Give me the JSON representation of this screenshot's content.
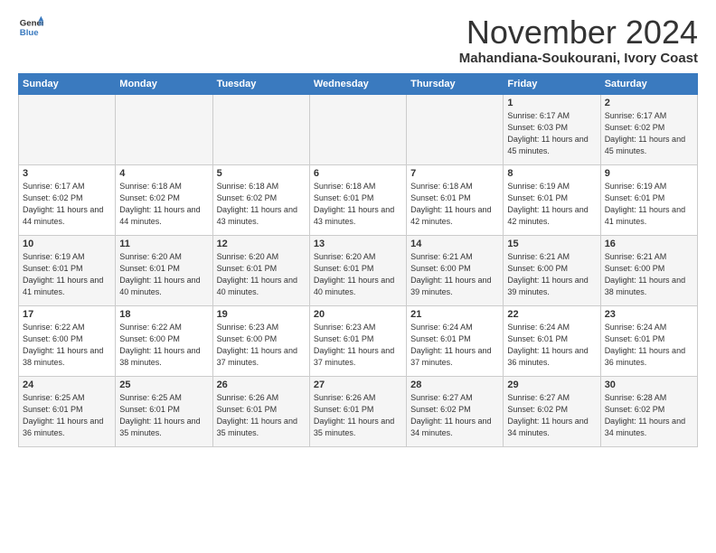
{
  "logo": {
    "general": "General",
    "blue": "Blue"
  },
  "title": "November 2024",
  "location": "Mahandiana-Soukourani, Ivory Coast",
  "days_header": [
    "Sunday",
    "Monday",
    "Tuesday",
    "Wednesday",
    "Thursday",
    "Friday",
    "Saturday"
  ],
  "weeks": [
    [
      {
        "day": "",
        "info": ""
      },
      {
        "day": "",
        "info": ""
      },
      {
        "day": "",
        "info": ""
      },
      {
        "day": "",
        "info": ""
      },
      {
        "day": "",
        "info": ""
      },
      {
        "day": "1",
        "info": "Sunrise: 6:17 AM\nSunset: 6:03 PM\nDaylight: 11 hours and 45 minutes."
      },
      {
        "day": "2",
        "info": "Sunrise: 6:17 AM\nSunset: 6:02 PM\nDaylight: 11 hours and 45 minutes."
      }
    ],
    [
      {
        "day": "3",
        "info": "Sunrise: 6:17 AM\nSunset: 6:02 PM\nDaylight: 11 hours and 44 minutes."
      },
      {
        "day": "4",
        "info": "Sunrise: 6:18 AM\nSunset: 6:02 PM\nDaylight: 11 hours and 44 minutes."
      },
      {
        "day": "5",
        "info": "Sunrise: 6:18 AM\nSunset: 6:02 PM\nDaylight: 11 hours and 43 minutes."
      },
      {
        "day": "6",
        "info": "Sunrise: 6:18 AM\nSunset: 6:01 PM\nDaylight: 11 hours and 43 minutes."
      },
      {
        "day": "7",
        "info": "Sunrise: 6:18 AM\nSunset: 6:01 PM\nDaylight: 11 hours and 42 minutes."
      },
      {
        "day": "8",
        "info": "Sunrise: 6:19 AM\nSunset: 6:01 PM\nDaylight: 11 hours and 42 minutes."
      },
      {
        "day": "9",
        "info": "Sunrise: 6:19 AM\nSunset: 6:01 PM\nDaylight: 11 hours and 41 minutes."
      }
    ],
    [
      {
        "day": "10",
        "info": "Sunrise: 6:19 AM\nSunset: 6:01 PM\nDaylight: 11 hours and 41 minutes."
      },
      {
        "day": "11",
        "info": "Sunrise: 6:20 AM\nSunset: 6:01 PM\nDaylight: 11 hours and 40 minutes."
      },
      {
        "day": "12",
        "info": "Sunrise: 6:20 AM\nSunset: 6:01 PM\nDaylight: 11 hours and 40 minutes."
      },
      {
        "day": "13",
        "info": "Sunrise: 6:20 AM\nSunset: 6:01 PM\nDaylight: 11 hours and 40 minutes."
      },
      {
        "day": "14",
        "info": "Sunrise: 6:21 AM\nSunset: 6:00 PM\nDaylight: 11 hours and 39 minutes."
      },
      {
        "day": "15",
        "info": "Sunrise: 6:21 AM\nSunset: 6:00 PM\nDaylight: 11 hours and 39 minutes."
      },
      {
        "day": "16",
        "info": "Sunrise: 6:21 AM\nSunset: 6:00 PM\nDaylight: 11 hours and 38 minutes."
      }
    ],
    [
      {
        "day": "17",
        "info": "Sunrise: 6:22 AM\nSunset: 6:00 PM\nDaylight: 11 hours and 38 minutes."
      },
      {
        "day": "18",
        "info": "Sunrise: 6:22 AM\nSunset: 6:00 PM\nDaylight: 11 hours and 38 minutes."
      },
      {
        "day": "19",
        "info": "Sunrise: 6:23 AM\nSunset: 6:00 PM\nDaylight: 11 hours and 37 minutes."
      },
      {
        "day": "20",
        "info": "Sunrise: 6:23 AM\nSunset: 6:01 PM\nDaylight: 11 hours and 37 minutes."
      },
      {
        "day": "21",
        "info": "Sunrise: 6:24 AM\nSunset: 6:01 PM\nDaylight: 11 hours and 37 minutes."
      },
      {
        "day": "22",
        "info": "Sunrise: 6:24 AM\nSunset: 6:01 PM\nDaylight: 11 hours and 36 minutes."
      },
      {
        "day": "23",
        "info": "Sunrise: 6:24 AM\nSunset: 6:01 PM\nDaylight: 11 hours and 36 minutes."
      }
    ],
    [
      {
        "day": "24",
        "info": "Sunrise: 6:25 AM\nSunset: 6:01 PM\nDaylight: 11 hours and 36 minutes."
      },
      {
        "day": "25",
        "info": "Sunrise: 6:25 AM\nSunset: 6:01 PM\nDaylight: 11 hours and 35 minutes."
      },
      {
        "day": "26",
        "info": "Sunrise: 6:26 AM\nSunset: 6:01 PM\nDaylight: 11 hours and 35 minutes."
      },
      {
        "day": "27",
        "info": "Sunrise: 6:26 AM\nSunset: 6:01 PM\nDaylight: 11 hours and 35 minutes."
      },
      {
        "day": "28",
        "info": "Sunrise: 6:27 AM\nSunset: 6:02 PM\nDaylight: 11 hours and 34 minutes."
      },
      {
        "day": "29",
        "info": "Sunrise: 6:27 AM\nSunset: 6:02 PM\nDaylight: 11 hours and 34 minutes."
      },
      {
        "day": "30",
        "info": "Sunrise: 6:28 AM\nSunset: 6:02 PM\nDaylight: 11 hours and 34 minutes."
      }
    ]
  ]
}
